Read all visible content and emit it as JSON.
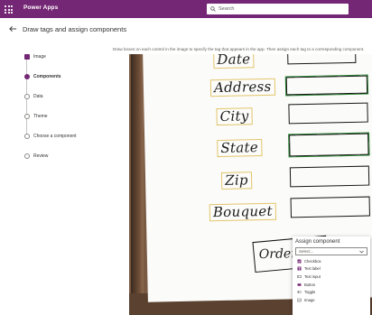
{
  "app": {
    "name": "Power Apps"
  },
  "search": {
    "placeholder": "Search"
  },
  "page": {
    "title": "Draw tags and assign components"
  },
  "instruction": "Draw boxes on each control in the image to specify the tag that appears in the app. Then assign each tag to a corresponding component.",
  "steps": [
    {
      "label": "Image",
      "state": "done"
    },
    {
      "label": "Components",
      "state": "current"
    },
    {
      "label": "Data",
      "state": "todo"
    },
    {
      "label": "Theme",
      "state": "todo"
    },
    {
      "label": "Choose a component",
      "state": "todo"
    },
    {
      "label": "Review",
      "state": "todo"
    }
  ],
  "drawing": {
    "labels": [
      "Date",
      "Address",
      "City",
      "State",
      "Zip",
      "Bouquet"
    ],
    "button_label": "Order"
  },
  "assign_component": {
    "title": "Assign component",
    "selected": "Select...",
    "options": [
      {
        "label": "Checkbox",
        "icon": "checkbox-icon"
      },
      {
        "label": "Text label",
        "icon": "text-label-icon"
      },
      {
        "label": "Text input",
        "icon": "text-input-icon"
      },
      {
        "label": "Button",
        "icon": "button-icon"
      },
      {
        "label": "Toggle",
        "icon": "toggle-icon"
      },
      {
        "label": "Image",
        "icon": "image-icon"
      }
    ]
  },
  "colors": {
    "brand": "#742774",
    "tag_border": "#e2c56a",
    "assigned_outline": "#2f8a3a"
  }
}
